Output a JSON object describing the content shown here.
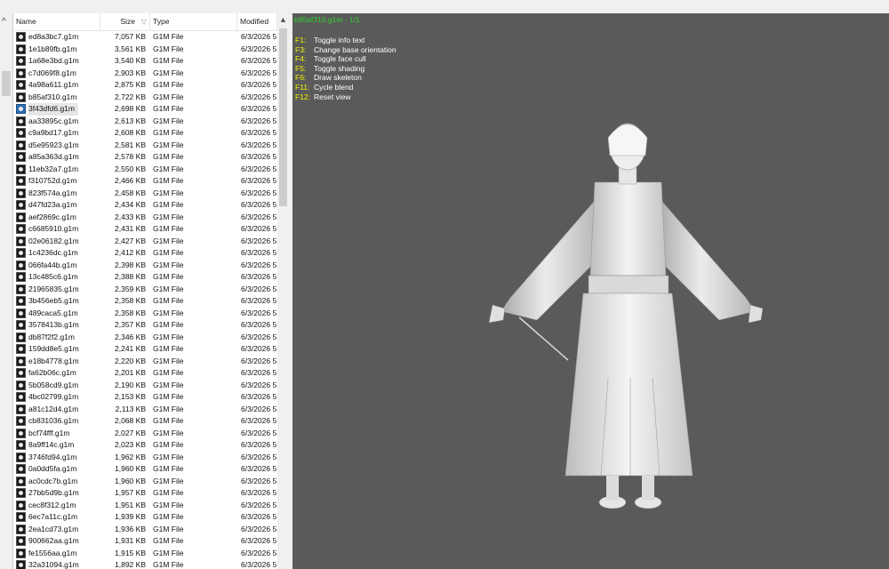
{
  "list": {
    "columns": {
      "name": "Name",
      "size": "Size",
      "type": "Type",
      "modified": "Modified"
    },
    "selected_index": 7,
    "rows": [
      {
        "name": "ed8a3bc7.g1m",
        "size": "7,057 KB",
        "type": "G1M File",
        "modified": "6/3/2026 5"
      },
      {
        "name": "1e1b89fb.g1m",
        "size": "3,561 KB",
        "type": "G1M File",
        "modified": "6/3/2026 5"
      },
      {
        "name": "1a68e3bd.g1m",
        "size": "3,540 KB",
        "type": "G1M File",
        "modified": "6/3/2026 5"
      },
      {
        "name": "c7d069f8.g1m",
        "size": "2,903 KB",
        "type": "G1M File",
        "modified": "6/3/2026 5"
      },
      {
        "name": "4a98a611.g1m",
        "size": "2,875 KB",
        "type": "G1M File",
        "modified": "6/3/2026 5"
      },
      {
        "name": "b85af310.g1m",
        "size": "2,722 KB",
        "type": "G1M File",
        "modified": "6/3/2026 5"
      },
      {
        "name": "3f43dfd6.g1m",
        "size": "2,698 KB",
        "type": "G1M File",
        "modified": "6/3/2026 5"
      },
      {
        "name": "aa33895c.g1m",
        "size": "2,613 KB",
        "type": "G1M File",
        "modified": "6/3/2026 5"
      },
      {
        "name": "c9a9bd17.g1m",
        "size": "2,608 KB",
        "type": "G1M File",
        "modified": "6/3/2026 5"
      },
      {
        "name": "d5e95923.g1m",
        "size": "2,581 KB",
        "type": "G1M File",
        "modified": "6/3/2026 5"
      },
      {
        "name": "a85a363d.g1m",
        "size": "2,578 KB",
        "type": "G1M File",
        "modified": "6/3/2026 5"
      },
      {
        "name": "11eb32a7.g1m",
        "size": "2,550 KB",
        "type": "G1M File",
        "modified": "6/3/2026 5"
      },
      {
        "name": "f310752d.g1m",
        "size": "2,466 KB",
        "type": "G1M File",
        "modified": "6/3/2026 5"
      },
      {
        "name": "823f574a.g1m",
        "size": "2,458 KB",
        "type": "G1M File",
        "modified": "6/3/2026 5"
      },
      {
        "name": "d47fd23a.g1m",
        "size": "2,434 KB",
        "type": "G1M File",
        "modified": "6/3/2026 5"
      },
      {
        "name": "aef2869c.g1m",
        "size": "2,433 KB",
        "type": "G1M File",
        "modified": "6/3/2026 5"
      },
      {
        "name": "c6685910.g1m",
        "size": "2,431 KB",
        "type": "G1M File",
        "modified": "6/3/2026 5"
      },
      {
        "name": "02e06182.g1m",
        "size": "2,427 KB",
        "type": "G1M File",
        "modified": "6/3/2026 5"
      },
      {
        "name": "1c4236dc.g1m",
        "size": "2,412 KB",
        "type": "G1M File",
        "modified": "6/3/2026 5"
      },
      {
        "name": "066fa44b.g1m",
        "size": "2,398 KB",
        "type": "G1M File",
        "modified": "6/3/2026 5"
      },
      {
        "name": "13c485c6.g1m",
        "size": "2,388 KB",
        "type": "G1M File",
        "modified": "6/3/2026 5"
      },
      {
        "name": "21965835.g1m",
        "size": "2,359 KB",
        "type": "G1M File",
        "modified": "6/3/2026 5"
      },
      {
        "name": "3b456eb5.g1m",
        "size": "2,358 KB",
        "type": "G1M File",
        "modified": "6/3/2026 5"
      },
      {
        "name": "489caca5.g1m",
        "size": "2,358 KB",
        "type": "G1M File",
        "modified": "6/3/2026 5"
      },
      {
        "name": "3578413b.g1m",
        "size": "2,357 KB",
        "type": "G1M File",
        "modified": "6/3/2026 5"
      },
      {
        "name": "db87f2f2.g1m",
        "size": "2,346 KB",
        "type": "G1M File",
        "modified": "6/3/2026 5"
      },
      {
        "name": "159dd8e5.g1m",
        "size": "2,241 KB",
        "type": "G1M File",
        "modified": "6/3/2026 5"
      },
      {
        "name": "e18b4778.g1m",
        "size": "2,220 KB",
        "type": "G1M File",
        "modified": "6/3/2026 5"
      },
      {
        "name": "fa62b06c.g1m",
        "size": "2,201 KB",
        "type": "G1M File",
        "modified": "6/3/2026 5"
      },
      {
        "name": "5b058cd9.g1m",
        "size": "2,190 KB",
        "type": "G1M File",
        "modified": "6/3/2026 5"
      },
      {
        "name": "4bc02799.g1m",
        "size": "2,153 KB",
        "type": "G1M File",
        "modified": "6/3/2026 5"
      },
      {
        "name": "a81c12d4.g1m",
        "size": "2,113 KB",
        "type": "G1M File",
        "modified": "6/3/2026 5"
      },
      {
        "name": "cb831036.g1m",
        "size": "2,068 KB",
        "type": "G1M File",
        "modified": "6/3/2026 5"
      },
      {
        "name": "bcf74fff.g1m",
        "size": "2,027 KB",
        "type": "G1M File",
        "modified": "6/3/2026 5"
      },
      {
        "name": "8a9ff14c.g1m",
        "size": "2,023 KB",
        "type": "G1M File",
        "modified": "6/3/2026 5"
      },
      {
        "name": "3746fd94.g1m",
        "size": "1,962 KB",
        "type": "G1M File",
        "modified": "6/3/2026 5"
      },
      {
        "name": "0a0dd5fa.g1m",
        "size": "1,960 KB",
        "type": "G1M File",
        "modified": "6/3/2026 5"
      },
      {
        "name": "ac0cdc7b.g1m",
        "size": "1,960 KB",
        "type": "G1M File",
        "modified": "6/3/2026 5"
      },
      {
        "name": "27bb5d9b.g1m",
        "size": "1,957 KB",
        "type": "G1M File",
        "modified": "6/3/2026 5"
      },
      {
        "name": "cec8f312.g1m",
        "size": "1,951 KB",
        "type": "G1M File",
        "modified": "6/3/2026 5"
      },
      {
        "name": "6ec7a11c.g1m",
        "size": "1,939 KB",
        "type": "G1M File",
        "modified": "6/3/2026 5"
      },
      {
        "name": "2ea1cd73.g1m",
        "size": "1,936 KB",
        "type": "G1M File",
        "modified": "6/3/2026 5"
      },
      {
        "name": "900662aa.g1m",
        "size": "1,931 KB",
        "type": "G1M File",
        "modified": "6/3/2026 5"
      },
      {
        "name": "fe1556aa.g1m",
        "size": "1,915 KB",
        "type": "G1M File",
        "modified": "6/3/2026 5"
      },
      {
        "name": "32a31094.g1m",
        "size": "1,892 KB",
        "type": "G1M File",
        "modified": "6/3/2026 5"
      }
    ]
  },
  "viewer": {
    "title": "b85af310.g1m - 1/1",
    "shortcuts": [
      {
        "key": "F1:",
        "label": "Toggle info text"
      },
      {
        "key": "F3:",
        "label": "Change base orientation"
      },
      {
        "key": "F4:",
        "label": "Toggle face cull"
      },
      {
        "key": "F5:",
        "label": "Toggle shading"
      },
      {
        "key": "F6:",
        "label": "Draw skeleton"
      },
      {
        "key": "F11:",
        "label": "Cycle blend"
      },
      {
        "key": "F12:",
        "label": "Reset view"
      }
    ]
  },
  "colors": {
    "viewport_bg": "#5a5a5a",
    "title_green": "#2fd12f",
    "key_yellow": "#f2f200",
    "selection_blue": "#2f6fb0"
  }
}
